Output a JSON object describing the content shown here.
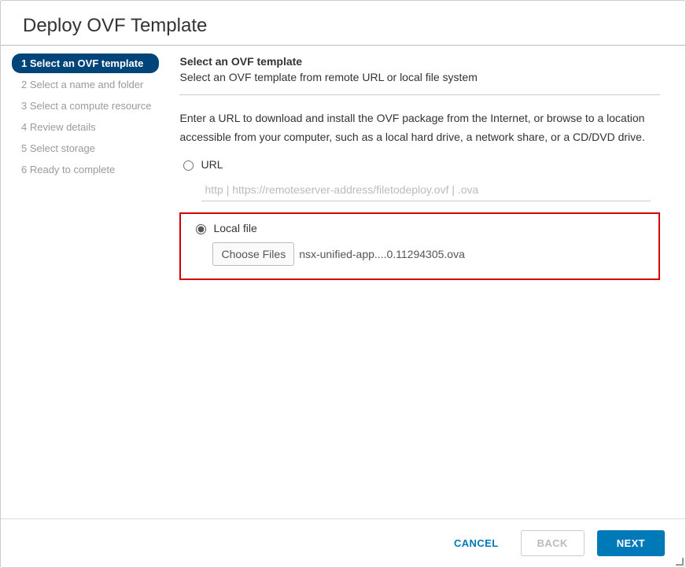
{
  "dialog": {
    "title": "Deploy OVF Template"
  },
  "steps": [
    {
      "label": "1 Select an OVF template",
      "active": true
    },
    {
      "label": "2 Select a name and folder",
      "active": false
    },
    {
      "label": "3 Select a compute resource",
      "active": false
    },
    {
      "label": "4 Review details",
      "active": false
    },
    {
      "label": "5 Select storage",
      "active": false
    },
    {
      "label": "6 Ready to complete",
      "active": false
    }
  ],
  "content": {
    "heading": "Select an OVF template",
    "subheading": "Select an OVF template from remote URL or local file system",
    "description": "Enter a URL to download and install the OVF package from the Internet, or browse to a location accessible from your computer, such as a local hard drive, a network share, or a CD/DVD drive.",
    "url_option_label": "URL",
    "url_placeholder": "http | https://remoteserver-address/filetodeploy.ovf | .ova",
    "local_option_label": "Local file",
    "choose_files_label": "Choose Files",
    "chosen_filename": "nsx-unified-app....0.11294305.ova",
    "selected_option": "local"
  },
  "footer": {
    "cancel": "CANCEL",
    "back": "BACK",
    "next": "NEXT"
  }
}
